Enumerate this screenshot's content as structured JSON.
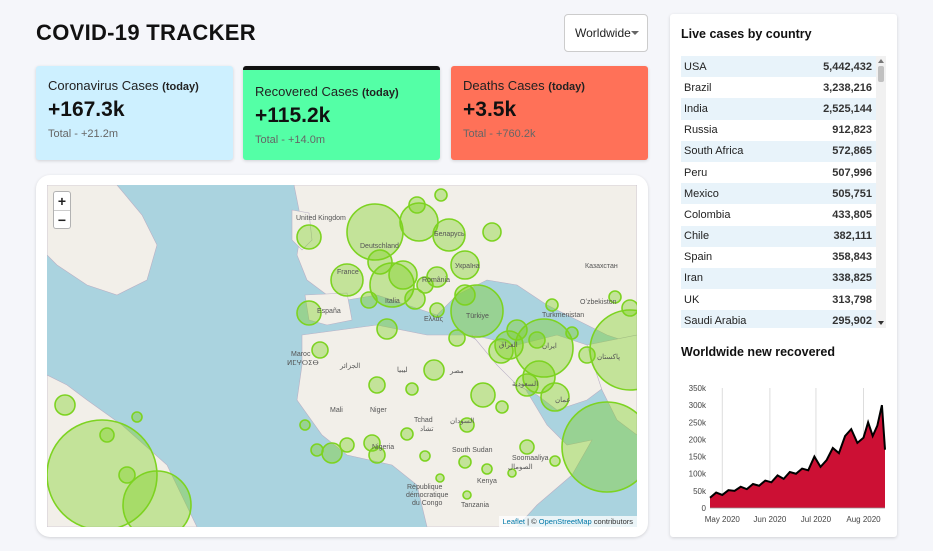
{
  "app": {
    "title": "COVID-19 TRACKER"
  },
  "country_select": {
    "selected": "Worldwide"
  },
  "cards": {
    "cases": {
      "title": "Coronavirus Cases",
      "today": "(today)",
      "value": "+167.3k",
      "total": "Total - +21.2m",
      "color": "#cdf0ff"
    },
    "recovered": {
      "title": "Recovered Cases",
      "today": "(today)",
      "value": "+115.2k",
      "total": "Total - +14.0m",
      "color": "#54ffa6"
    },
    "deaths": {
      "title": "Deaths Cases",
      "today": "(today)",
      "value": "+3.5k",
      "total": "Total - +760.2k",
      "color": "#ff7158"
    }
  },
  "map": {
    "zoom_in": "+",
    "zoom_out": "−",
    "attribution_leaflet": "Leaflet",
    "attribution_sep": " | © ",
    "attribution_osm": "OpenStreetMap",
    "attribution_suffix": " contributors",
    "circle_color": "#7dd321",
    "labels": {
      "uk": "United Kingdom",
      "de": "Deutschland",
      "fr": "France",
      "es": "España",
      "it": "Italia",
      "ro": "România",
      "by": "Беларусь",
      "ua": "Україна",
      "kz": "Казахстан",
      "uz": "Oʻzbekiston",
      "tr": "Türkiye",
      "tm": "Turkmenistan",
      "ir": "ایران",
      "iq": "العراق",
      "sa": "السعودية",
      "om": "عمان",
      "pk": "پاکستان",
      "eg": "مصر",
      "ly": "ليبيا",
      "dz": "الجزائر",
      "ma1": "Maroc",
      "ma2": "ⵍⵎⵖⵔⵉⴱ",
      "ml": "Mali",
      "ne": "Niger",
      "td1": "Tchad",
      "td2": "تشاد",
      "sd": "السودان",
      "ng": "Nigeria",
      "ss": "South Sudan",
      "so1": "Soomaaliya",
      "so2": "الصومال",
      "ke": "Kenya",
      "cd1": "République",
      "cd2": "démocratique",
      "cd3": "du Congo",
      "tz": "Tanzania",
      "gr": "Ελλάς"
    }
  },
  "live_table": {
    "heading": "Live cases by country",
    "rows": [
      {
        "country": "USA",
        "cases": "5,442,432"
      },
      {
        "country": "Brazil",
        "cases": "3,238,216"
      },
      {
        "country": "India",
        "cases": "2,525,144"
      },
      {
        "country": "Russia",
        "cases": "912,823"
      },
      {
        "country": "South Africa",
        "cases": "572,865"
      },
      {
        "country": "Peru",
        "cases": "507,996"
      },
      {
        "country": "Mexico",
        "cases": "505,751"
      },
      {
        "country": "Colombia",
        "cases": "433,805"
      },
      {
        "country": "Chile",
        "cases": "382,111"
      },
      {
        "country": "Spain",
        "cases": "358,843"
      },
      {
        "country": "Iran",
        "cases": "338,825"
      },
      {
        "country": "UK",
        "cases": "313,798"
      },
      {
        "country": "Saudi Arabia",
        "cases": "295,902"
      }
    ]
  },
  "chart_heading": "Worldwide new recovered",
  "chart_data": {
    "type": "area",
    "title": "Worldwide new recovered",
    "xlabel": "",
    "ylabel": "",
    "x_tick_labels": [
      "May 2020",
      "Jun 2020",
      "Jul 2020",
      "Aug 2020"
    ],
    "y_tick_labels": [
      "0",
      "50k",
      "100k",
      "150k",
      "200k",
      "250k",
      "300k",
      "350k"
    ],
    "ylim": [
      0,
      350000
    ],
    "grid": "vertical",
    "fill_color": "#cc1034",
    "line_color": "#000000",
    "x": [
      "2020-04-23",
      "2020-04-27",
      "2020-05-01",
      "2020-05-05",
      "2020-05-09",
      "2020-05-13",
      "2020-05-17",
      "2020-05-21",
      "2020-05-25",
      "2020-05-29",
      "2020-06-02",
      "2020-06-06",
      "2020-06-10",
      "2020-06-14",
      "2020-06-18",
      "2020-06-22",
      "2020-06-26",
      "2020-06-30",
      "2020-07-04",
      "2020-07-08",
      "2020-07-12",
      "2020-07-16",
      "2020-07-20",
      "2020-07-24",
      "2020-07-28",
      "2020-08-01",
      "2020-08-04",
      "2020-08-07",
      "2020-08-10",
      "2020-08-13",
      "2020-08-15"
    ],
    "values": [
      30000,
      45000,
      38000,
      52000,
      50000,
      62000,
      55000,
      70000,
      65000,
      80000,
      75000,
      95000,
      85000,
      105000,
      100000,
      115000,
      110000,
      150000,
      120000,
      140000,
      175000,
      160000,
      210000,
      230000,
      190000,
      205000,
      250000,
      210000,
      240000,
      300000,
      170000
    ]
  }
}
